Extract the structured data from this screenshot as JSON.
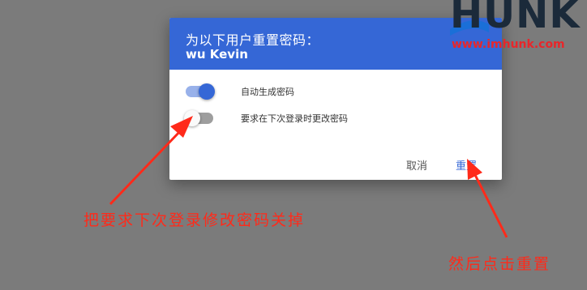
{
  "dialog": {
    "title": "为以下用户重置密码：",
    "user": "wu Kevin",
    "options": [
      {
        "label": "自动生成密码",
        "state": "on"
      },
      {
        "label": "要求在下次登录时更改密码",
        "state": "off"
      }
    ],
    "cancel_label": "取消",
    "reset_label": "重置"
  },
  "watermark": {
    "brand": "HUNK",
    "url": "www.imhunk.com"
  },
  "annotations": {
    "toggle_note": "把要求下次登录修改密码关掉",
    "reset_note": "然后点击重置"
  },
  "colors": {
    "accent": "#3567d6",
    "annotation": "#ff2a1a",
    "overlay": "#7b7b7b"
  }
}
